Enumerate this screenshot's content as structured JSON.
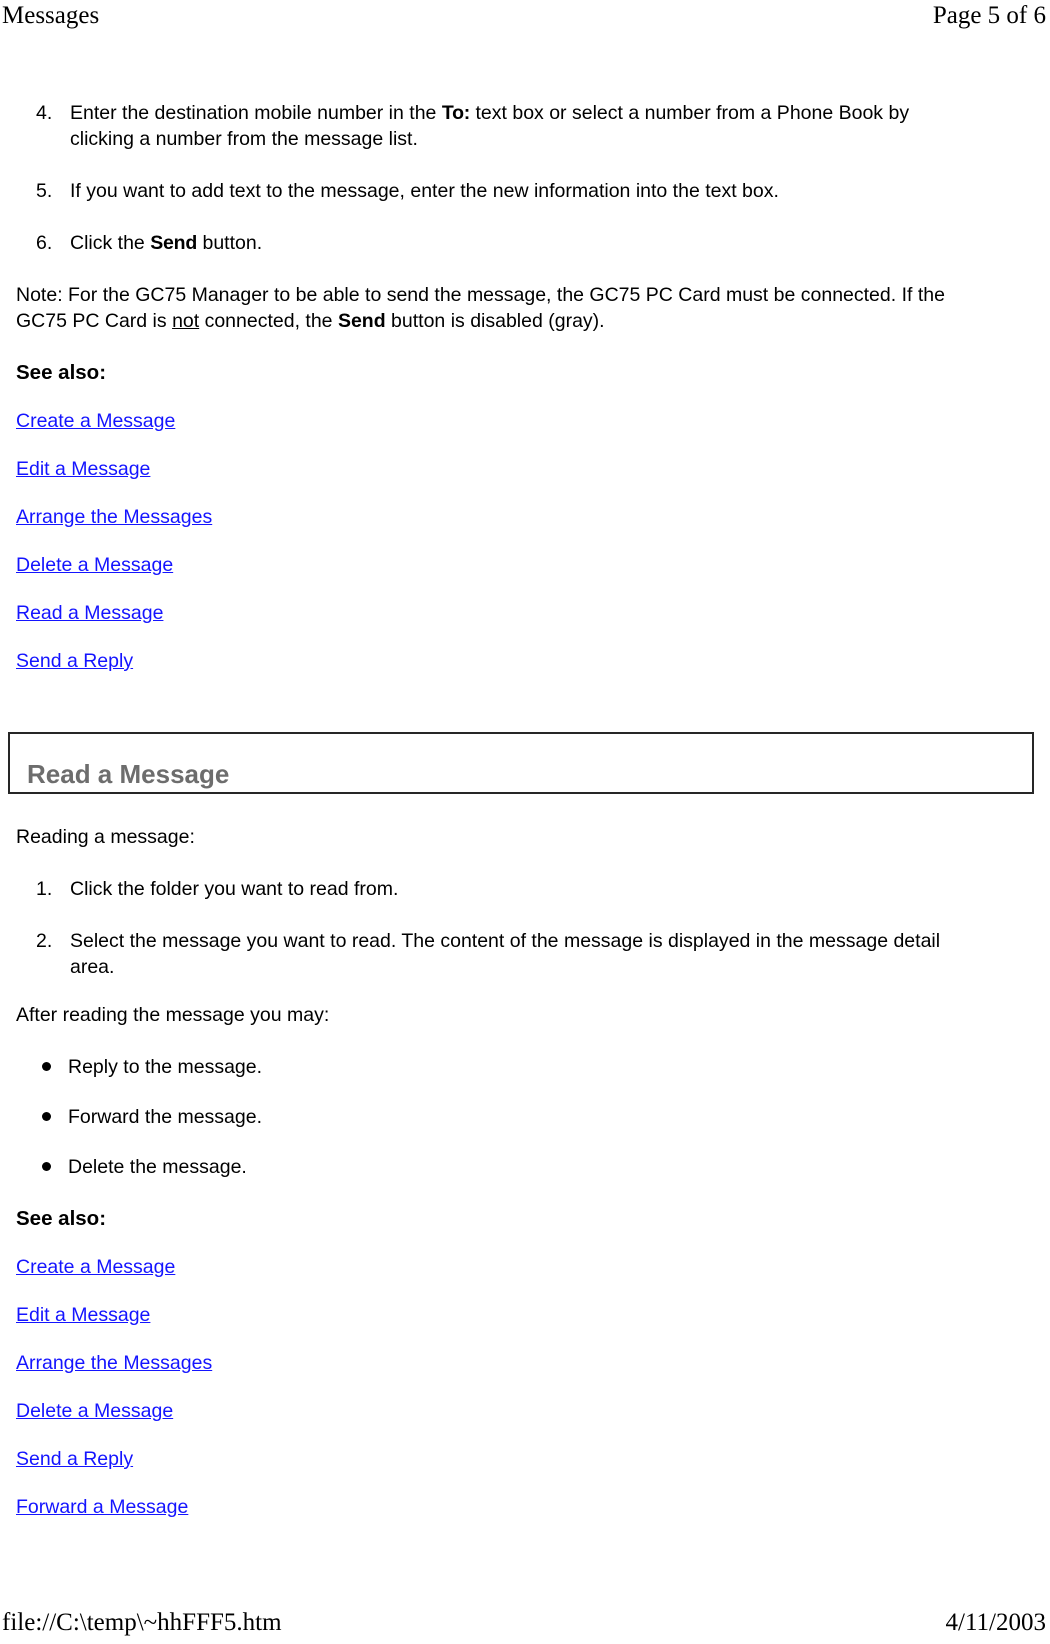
{
  "header": {
    "left": "Messages",
    "right": "Page 5 of 6"
  },
  "footer": {
    "left": "file://C:\\temp\\~hhFFF5.htm",
    "right": "4/11/2003"
  },
  "colors": {
    "link": "#1414ff",
    "heading_gray": "#6d6d6d",
    "box_border": "#262626",
    "text": "#000000"
  },
  "section_send": {
    "steps": [
      {
        "marker": "4.",
        "text_before": "Enter the destination mobile number in the ",
        "term": "To:",
        "text_after": " text box or select a number from a Phone Book by clicking a number from the message list."
      },
      {
        "marker": "5.",
        "text_before": "If you want to add text to the message, enter the new information into the text box.",
        "term": "",
        "text_after": ""
      },
      {
        "marker": "6.",
        "text_before": "Click the ",
        "term": "Send",
        "text_after": " button."
      }
    ],
    "note": {
      "part1": "Note: For the GC75 Manager to be able to send the message, the GC75 PC Card must be connected. If the GC75 PC Card is ",
      "underlined": "not",
      "part2": " connected, the ",
      "bold": "Send",
      "part3": " button is disabled (gray)."
    },
    "see_also_label": "See also:",
    "links": [
      "Create a Message",
      "Edit a Message",
      "Arrange the Messages",
      "Delete a Message",
      "Read a Message",
      "Send a Reply"
    ]
  },
  "section_read": {
    "heading": "Read a Message",
    "intro": "Reading a message:",
    "steps": [
      {
        "marker": "1.",
        "text": "Click the folder you want to read from."
      },
      {
        "marker": "2.",
        "text": "Select the message you want to read. The content of the message is displayed in the message detail area."
      }
    ],
    "after_label": "After reading the message you may:",
    "bullets": [
      "Reply to the message.",
      "Forward the message.",
      "Delete the message."
    ],
    "see_also_label": "See also:",
    "links": [
      "Create a Message",
      "Edit a Message",
      "Arrange the Messages",
      "Delete a Message",
      "Send a Reply",
      "Forward a Message"
    ]
  }
}
